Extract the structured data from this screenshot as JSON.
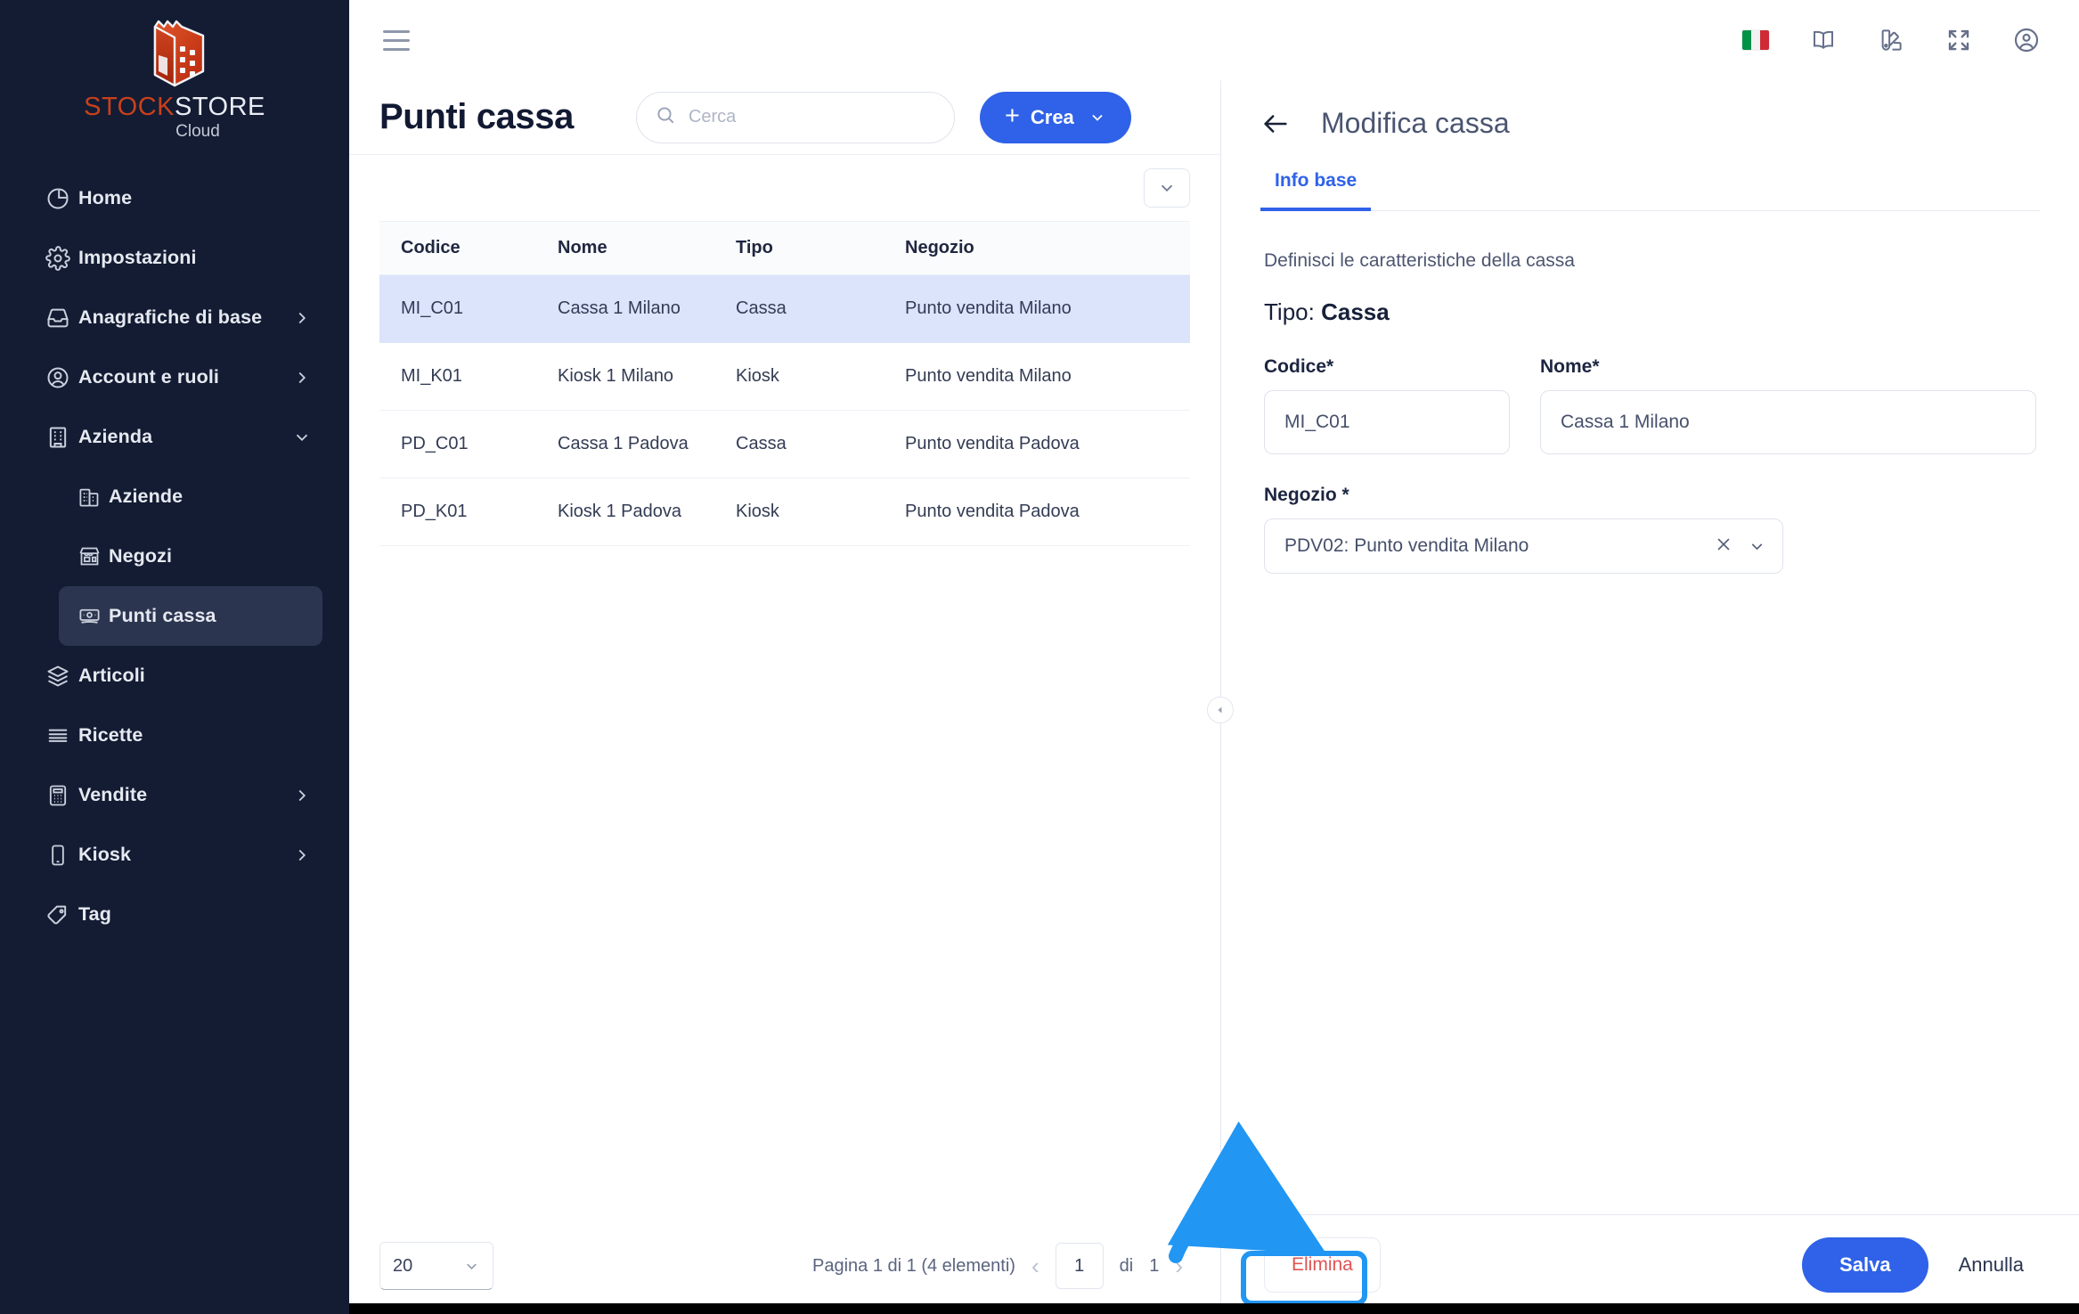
{
  "brand": {
    "name_part1": "STOCK",
    "name_part2": "STORE",
    "subtitle": "Cloud",
    "logo_icon": "warehouse-cube-icon",
    "accent_red": "#c8401c",
    "accent_blue": "#2f62e8",
    "sidebar_bg": "#131c33"
  },
  "topbar": {
    "menu_icon": "hamburger-icon",
    "icons": [
      {
        "name": "language-flag-italian-icon",
        "label": "IT"
      },
      {
        "name": "documentation-book-icon",
        "label": ""
      },
      {
        "name": "theme-palette-icon",
        "label": ""
      },
      {
        "name": "fullscreen-icon",
        "label": ""
      },
      {
        "name": "user-account-icon",
        "label": ""
      }
    ]
  },
  "sidebar": {
    "items": [
      {
        "label": "Home",
        "icon": "pie-chart-icon",
        "expandable": false,
        "active": false,
        "sub": false
      },
      {
        "label": "Impostazioni",
        "icon": "gear-icon",
        "expandable": false,
        "active": false,
        "sub": false
      },
      {
        "label": "Anagrafiche di base",
        "icon": "inbox-tray-icon",
        "expandable": true,
        "active": false,
        "sub": false
      },
      {
        "label": "Account e ruoli",
        "icon": "user-circle-icon",
        "expandable": true,
        "active": false,
        "sub": false
      },
      {
        "label": "Azienda",
        "icon": "office-building-icon",
        "expandable": true,
        "expanded": true,
        "active": false,
        "sub": false
      },
      {
        "label": "Aziende",
        "icon": "buildings-icon",
        "expandable": false,
        "active": false,
        "sub": true
      },
      {
        "label": "Negozi",
        "icon": "storefront-icon",
        "expandable": false,
        "active": false,
        "sub": true
      },
      {
        "label": "Punti cassa",
        "icon": "cash-register-icon",
        "expandable": false,
        "active": true,
        "sub": true
      },
      {
        "label": "Articoli",
        "icon": "layers-icon",
        "expandable": false,
        "active": false,
        "sub": false
      },
      {
        "label": "Ricette",
        "icon": "recipe-lines-icon",
        "expandable": false,
        "active": false,
        "sub": false
      },
      {
        "label": "Vendite",
        "icon": "calculator-icon",
        "expandable": true,
        "active": false,
        "sub": false
      },
      {
        "label": "Kiosk",
        "icon": "tablet-icon",
        "expandable": true,
        "active": false,
        "sub": false
      },
      {
        "label": "Tag",
        "icon": "tag-icon",
        "expandable": false,
        "active": false,
        "sub": false
      }
    ]
  },
  "list": {
    "title": "Punti cassa",
    "search_placeholder": "Cerca",
    "search_value": "",
    "create_label": "Crea",
    "columns": [
      "Codice",
      "Nome",
      "Tipo",
      "Negozio"
    ],
    "rows": [
      {
        "codice": "MI_C01",
        "nome": "Cassa 1 Milano",
        "tipo": "Cassa",
        "negozio": "Punto vendita Milano",
        "selected": true
      },
      {
        "codice": "MI_K01",
        "nome": "Kiosk 1 Milano",
        "tipo": "Kiosk",
        "negozio": "Punto vendita Milano",
        "selected": false
      },
      {
        "codice": "PD_C01",
        "nome": "Cassa 1 Padova",
        "tipo": "Cassa",
        "negozio": "Punto vendita Padova",
        "selected": false
      },
      {
        "codice": "PD_K01",
        "nome": "Kiosk 1 Padova",
        "tipo": "Kiosk",
        "negozio": "Punto vendita Padova",
        "selected": false
      }
    ]
  },
  "pager": {
    "page_size": "20",
    "info": "Pagina 1 di 1 (4 elementi)",
    "current_page": "1",
    "of_label": "di",
    "total_pages": "1"
  },
  "detail": {
    "back_icon": "arrow-left-icon",
    "title": "Modifica cassa",
    "tabs": [
      {
        "label": "Info base",
        "active": true
      }
    ],
    "hint": "Definisci le caratteristiche della cassa",
    "tipo_label": "Tipo:",
    "tipo_value": "Cassa",
    "fields": {
      "codice_label": "Codice*",
      "codice_value": "MI_C01",
      "nome_label": "Nome*",
      "nome_value": "Cassa 1 Milano",
      "negozio_label": "Negozio *",
      "negozio_value": "PDV02: Punto vendita Milano"
    },
    "footer": {
      "delete_label": "Elimina",
      "save_label": "Salva",
      "cancel_label": "Annulla"
    }
  },
  "annotation": {
    "highlight_color": "#2196f3",
    "target": "Elimina"
  }
}
